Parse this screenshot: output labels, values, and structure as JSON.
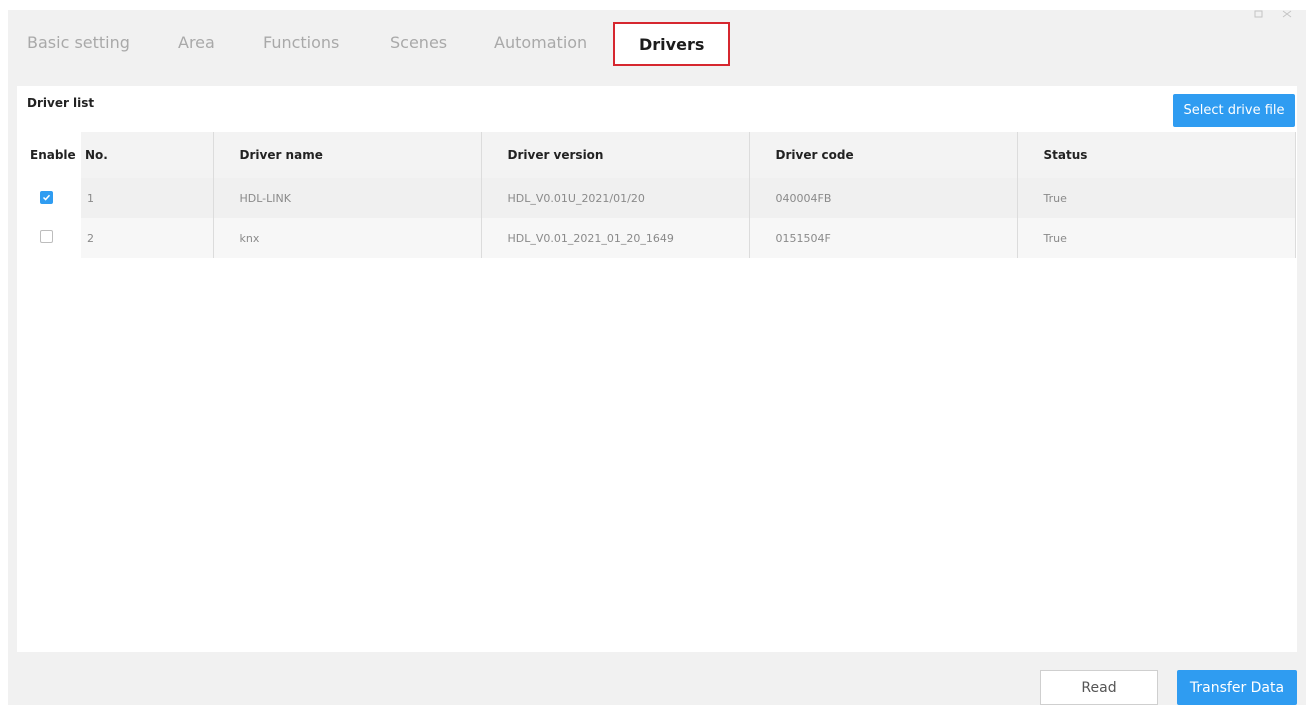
{
  "tabs": [
    {
      "label": "Basic setting"
    },
    {
      "label": "Area"
    },
    {
      "label": "Functions"
    },
    {
      "label": "Scenes"
    },
    {
      "label": "Automation"
    },
    {
      "label": "Drivers",
      "active": true
    }
  ],
  "panel": {
    "title": "Driver list",
    "select_file_label": "Select drive file"
  },
  "table": {
    "columns": [
      "Enable",
      "No.",
      "Driver name",
      "Driver version",
      "Driver code",
      "Status"
    ],
    "rows": [
      {
        "enabled": true,
        "no": "1",
        "name": "HDL-LINK",
        "version": "HDL_V0.01U_2021/01/20",
        "code": "040004FB",
        "status": "True"
      },
      {
        "enabled": false,
        "no": "2",
        "name": "knx",
        "version": "HDL_V0.01_2021_01_20_1649",
        "code": "0151504F",
        "status": "True"
      }
    ]
  },
  "footer": {
    "read_label": "Read",
    "transfer_label": "Transfer Data"
  },
  "colors": {
    "accent": "#2f9cf1",
    "active_tab_border": "#d6272f"
  },
  "icons": {
    "window_restore": "restore-icon",
    "window_close": "close-icon",
    "checkbox_checked": "check-icon"
  }
}
